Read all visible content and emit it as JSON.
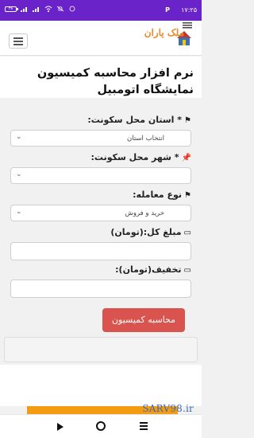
{
  "status": {
    "time": "۱۷:۲۵",
    "p_icon": "P",
    "battery_text": "۳۸",
    "icons": [
      "battery-icon",
      "signal-icon",
      "signal-icon",
      "wifi-icon",
      "bell-off-icon",
      "alarm-icon"
    ]
  },
  "header": {
    "logo_text": "ملک یاران",
    "menu_icon": "hamburger-icon"
  },
  "page": {
    "title": "نرم افزار محاسبه کمیسیون نمایشگاه اتومبیل"
  },
  "form": {
    "province_label": "* استان محل سکونت:",
    "province_value": "انتخاب استان",
    "city_label": "* شهر محل سکونت:",
    "city_value": "",
    "deal_label": "نوع معامله:",
    "deal_value": "خرید و فروش",
    "amount_label": "مبلغ کل:(تومان)",
    "amount_value": "",
    "discount_label": "تخفیف(تومان):",
    "discount_value": "",
    "submit_label": "محاسبه کمیسیون"
  },
  "footer": {
    "watermark": "SARV98.ir"
  }
}
